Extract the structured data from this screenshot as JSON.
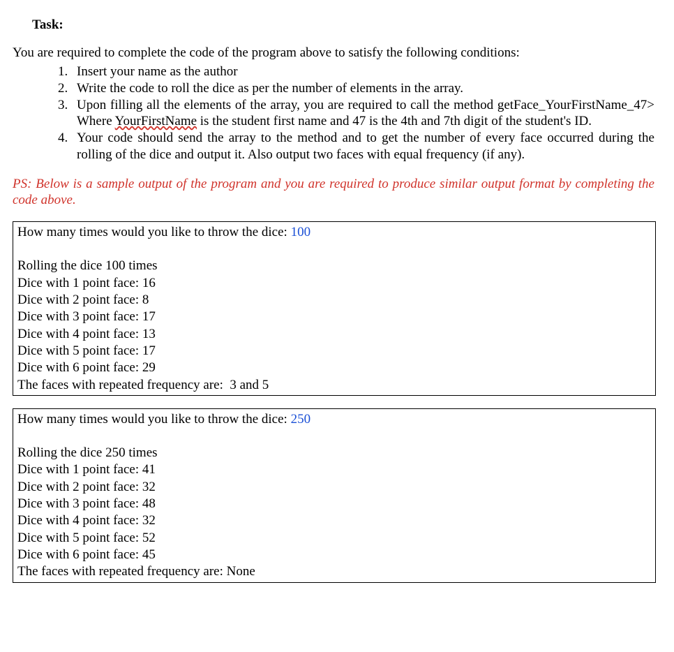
{
  "heading": "Task:",
  "intro": "You are required to complete the code of the program above to satisfy the following conditions:",
  "conditions": {
    "item1": "Insert your name as the author",
    "item2": "Write the code to roll the dice as per the number of elements in the array.",
    "item3_a": "Upon filling all the elements of the array, you are required to call the method getFace_YourFirstName_47> Where ",
    "item3_wavy": "YourFirstName",
    "item3_b": " is the student first name and 47 is the 4th and 7th digit of the student's ID.",
    "item4": "Your code should send the array to the method and to get the number of every face occurred during the rolling of the dice and output it. Also output two faces with equal frequency (if any)."
  },
  "ps": "PS: Below is a sample output of the program and you are required to produce similar output format by completing the code above.",
  "sample1": {
    "prompt": "How many times would you like to throw the dice: ",
    "input": "100",
    "rolling": "Rolling the dice 100 times",
    "f1": "Dice with 1 point face: 16",
    "f2": "Dice with 2 point face: 8",
    "f3": "Dice with 3 point face: 17",
    "f4": "Dice with 4 point face: 13",
    "f5": "Dice with 5 point face: 17",
    "f6": "Dice with 6 point face: 29",
    "repeated": "The faces with repeated frequency are:  3 and 5"
  },
  "sample2": {
    "prompt": "How many times would you like to throw the dice: ",
    "input": "250",
    "rolling": "Rolling the dice 250 times",
    "f1": "Dice with 1 point face: 41",
    "f2": "Dice with 2 point face: 32",
    "f3": "Dice with 3 point face: 48",
    "f4": "Dice with 4 point face: 32",
    "f5": "Dice with 5 point face: 52",
    "f6": "Dice with 6 point face: 45",
    "repeated": "The faces with repeated frequency are: None"
  }
}
